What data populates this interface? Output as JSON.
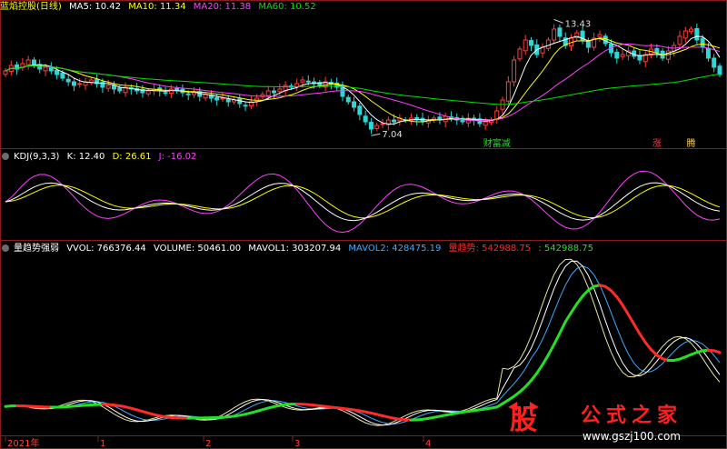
{
  "main_panel": {
    "title": "蓝焰控股(日线)",
    "ma5_label": "MA5: 10.42",
    "ma10_label": "MA10: 11.34",
    "ma20_label": "MA20: 11.38",
    "ma60_label": "MA60: 10.52",
    "high_label": "13.43",
    "low_label": "7.04",
    "signal_buy": "财富减",
    "signal_zhang": "涨",
    "signal_teng": "腾",
    "colors": {
      "up": "#ff3c3c",
      "down": "#2fd6d6",
      "ma5": "#ffffff",
      "ma10": "#ffff00",
      "ma20": "#ff40ff",
      "ma60": "#00e000"
    }
  },
  "kdj_panel": {
    "title": "KDJ(9,3,3)",
    "k_label": "K: 12.40",
    "d_label": "D: 26.61",
    "j_label": "J: -16.02"
  },
  "vol_panel": {
    "title": "量趋势强弱",
    "vvol_label": "VVOL: 766376.44",
    "volume_label": "VOLUME: 50461.00",
    "mavol1_label": "MAVOL1: 303207.94",
    "mavol2_label": "MAVOL2: 428475.19",
    "trend_label": "量趋势: 542988.75",
    "trend2_label": ": 542988.75"
  },
  "x_axis": {
    "ticks": [
      "2021年",
      "1",
      "2",
      "3",
      "4"
    ]
  },
  "watermark": {
    "logo_char": "股",
    "brand": "公式之家",
    "url": "www.gszj100.com"
  },
  "chart_data": {
    "type": "candlestick",
    "price_closes": [
      10.6,
      10.9,
      10.7,
      11.0,
      11.2,
      10.9,
      10.7,
      10.8,
      10.6,
      10.4,
      10.2,
      10.0,
      9.8,
      9.9,
      10.0,
      10.1,
      9.9,
      9.7,
      9.8,
      9.6,
      9.5,
      9.7,
      9.6,
      9.5,
      9.4,
      9.5,
      9.6,
      9.5,
      9.4,
      9.6,
      9.5,
      9.4,
      9.3,
      9.4,
      9.2,
      9.3,
      9.1,
      9.0,
      9.1,
      8.9,
      9.0,
      8.8,
      8.7,
      8.9,
      9.1,
      9.3,
      9.5,
      9.4,
      9.6,
      9.8,
      9.7,
      9.9,
      10.1,
      10.0,
      9.9,
      9.8,
      10.0,
      9.9,
      9.7,
      9.2,
      8.9,
      8.6,
      8.2,
      7.8,
      7.4,
      7.6,
      7.7,
      7.9,
      7.8,
      8.0,
      7.9,
      8.0,
      7.9,
      7.8,
      7.9,
      8.0,
      7.9,
      8.1,
      8.0,
      7.9,
      7.8,
      8.0,
      7.9,
      7.7,
      7.8,
      7.9,
      8.4,
      9.0,
      10.0,
      11.2,
      11.8,
      12.3,
      12.0,
      11.5,
      11.9,
      12.3,
      12.9,
      12.5,
      12.0,
      12.4,
      12.7,
      12.3,
      11.9,
      12.4,
      12.6,
      12.1,
      11.6,
      11.3,
      11.5,
      11.7,
      11.4,
      11.2,
      11.5,
      11.8,
      11.6,
      11.3,
      11.7,
      12.0,
      12.5,
      12.8,
      12.9,
      12.3,
      11.9,
      11.3,
      10.8,
      10.4
    ],
    "ma_values": {
      "MA5": 10.42,
      "MA10": 11.34,
      "MA20": 11.38,
      "MA60": 10.52
    },
    "high": 13.43,
    "low": 7.04,
    "kdj": {
      "K": 12.4,
      "D": 26.61,
      "J": -16.02
    },
    "volume_trend": {
      "VVOL": 766376.44,
      "VOLUME": 50461.0,
      "MAVOL1": 303207.94,
      "MAVOL2": 428475.19,
      "trend": 542988.75
    }
  }
}
